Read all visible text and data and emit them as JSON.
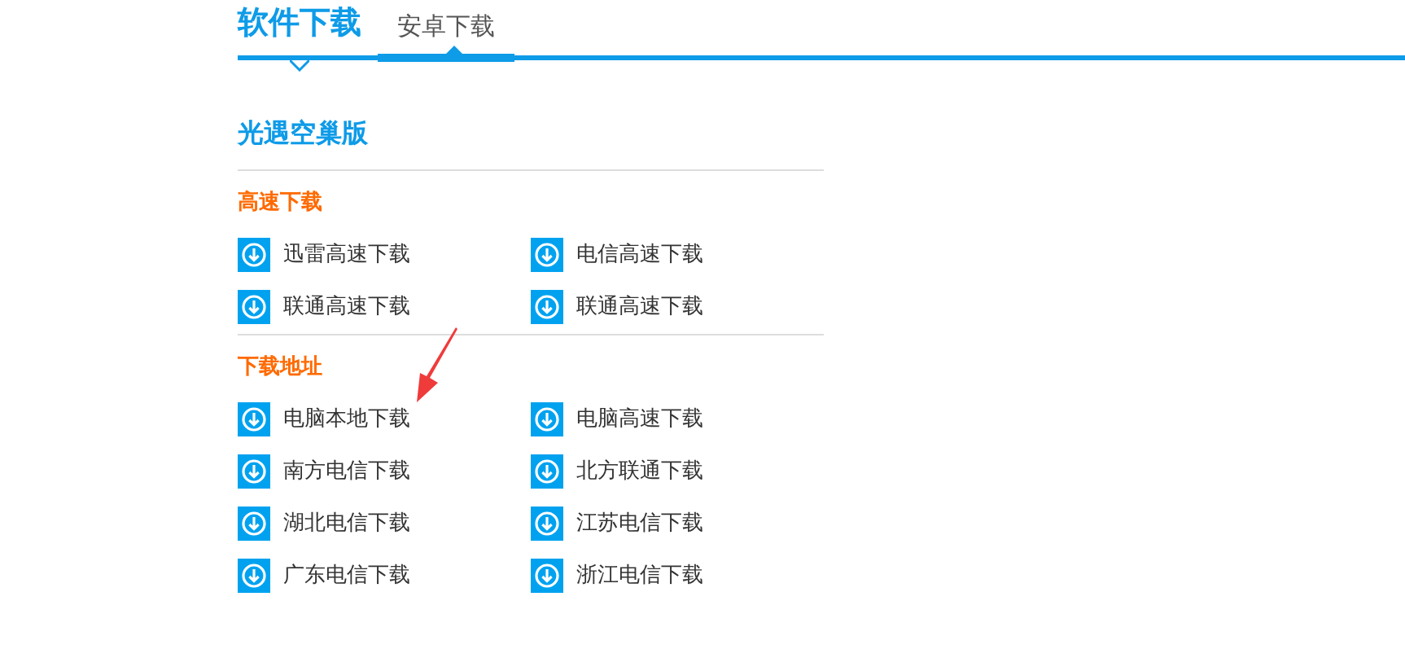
{
  "header": {
    "title": "软件下载",
    "tabs": [
      {
        "label": "安卓下载",
        "selected": true
      }
    ]
  },
  "app_title": "光遇空巢版",
  "groups": [
    {
      "heading": "高速下载",
      "links": [
        "迅雷高速下载",
        "电信高速下载",
        "联通高速下载",
        "联通高速下载"
      ]
    },
    {
      "heading": "下载地址",
      "links": [
        "电脑本地下载",
        "电脑高速下载",
        "南方电信下载",
        "北方联通下载",
        "湖北电信下载",
        "江苏电信下载",
        "广东电信下载",
        "浙江电信下载"
      ]
    }
  ],
  "annotation": {
    "kind": "arrow",
    "color": "#f03b3b"
  }
}
